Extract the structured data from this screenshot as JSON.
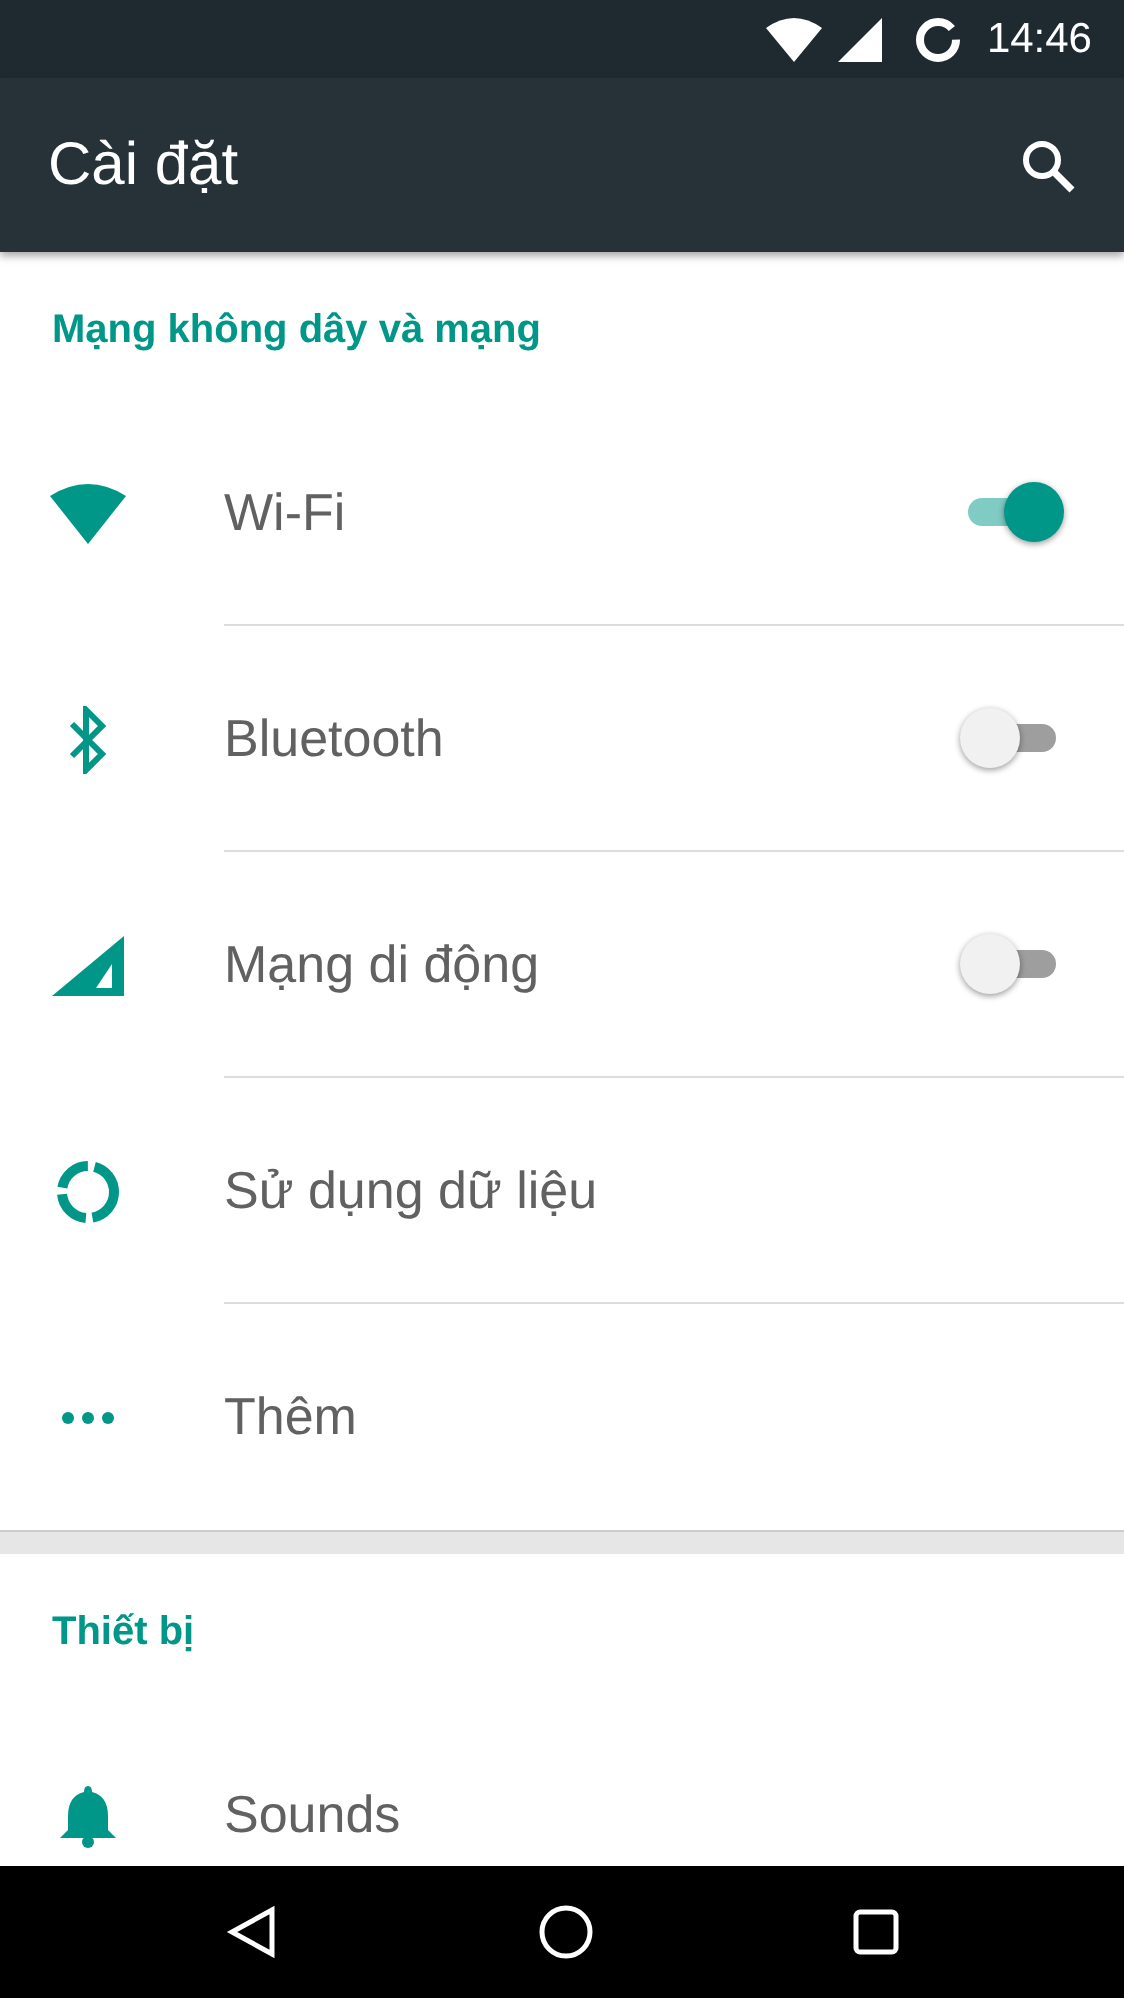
{
  "status_bar": {
    "time": "14:46"
  },
  "app_bar": {
    "title": "Cài đặt"
  },
  "sections": [
    {
      "header": "Mạng không dây và mạng",
      "items": [
        {
          "label": "Wi-Fi",
          "kind": "toggle",
          "on": true
        },
        {
          "label": "Bluetooth",
          "kind": "toggle",
          "on": false
        },
        {
          "label": "Mạng di động",
          "kind": "toggle",
          "on": false
        },
        {
          "label": "Sử dụng dữ liệu",
          "kind": "plain"
        },
        {
          "label": "Thêm",
          "kind": "plain"
        }
      ]
    },
    {
      "header": "Thiết bị",
      "items": [
        {
          "label": "Sounds",
          "kind": "plain"
        }
      ]
    }
  ]
}
